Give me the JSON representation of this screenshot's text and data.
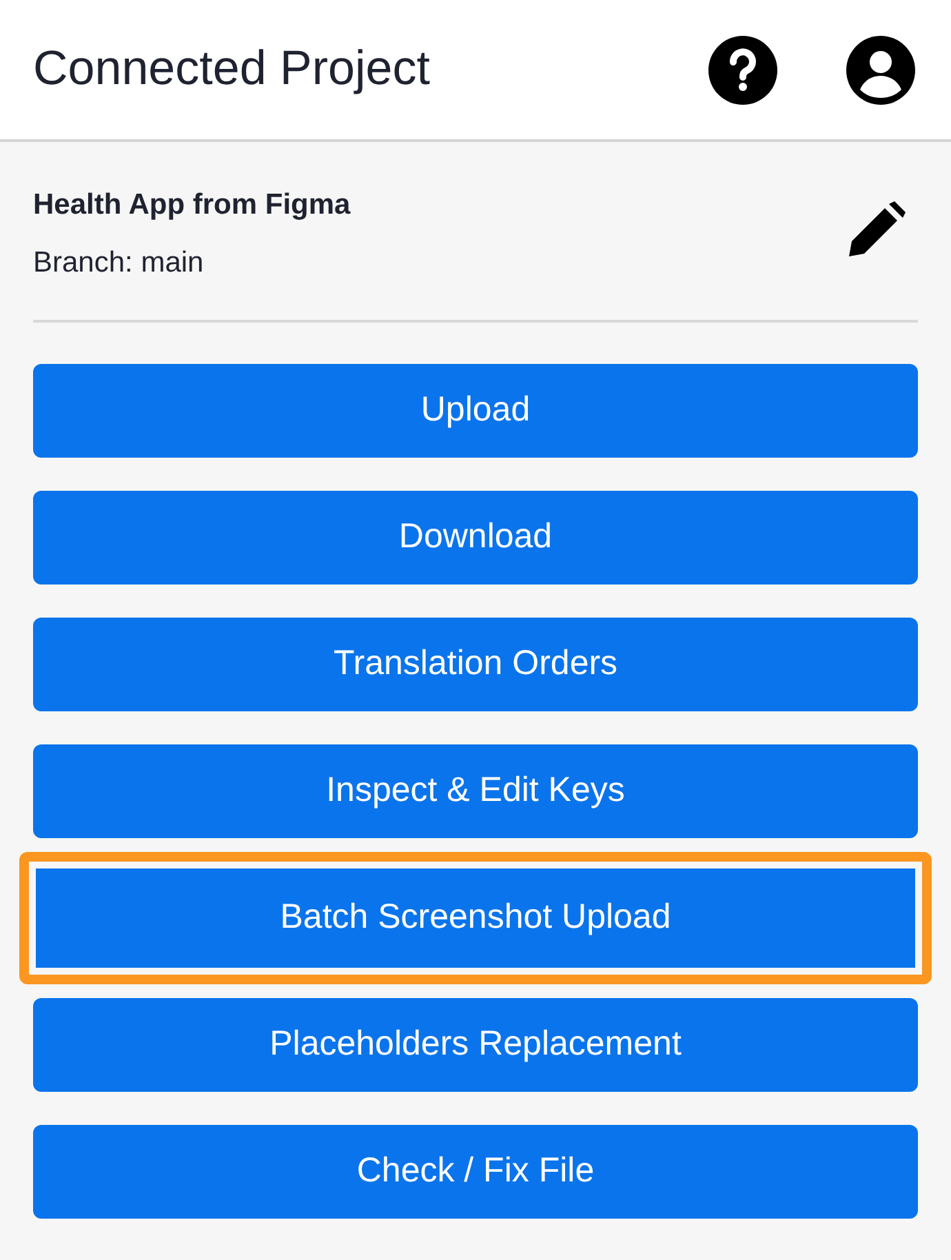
{
  "header": {
    "title": "Connected Project"
  },
  "project": {
    "name": "Health App from Figma",
    "branch": "Branch: main"
  },
  "buttons": [
    {
      "label": "Upload",
      "highlighted": false
    },
    {
      "label": "Download",
      "highlighted": false
    },
    {
      "label": "Translation Orders",
      "highlighted": false
    },
    {
      "label": "Inspect & Edit Keys",
      "highlighted": false
    },
    {
      "label": "Batch Screenshot Upload",
      "highlighted": true
    },
    {
      "label": "Placeholders Replacement",
      "highlighted": false
    },
    {
      "label": "Check / Fix File",
      "highlighted": false
    }
  ]
}
